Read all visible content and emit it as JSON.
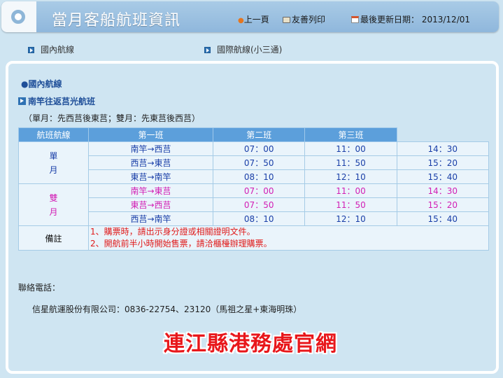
{
  "header": {
    "site_title": "當月客船航班資訊",
    "prev_link": "上一頁",
    "print_link": "友善列印",
    "update_label": "最後更新日期：",
    "update_date": "2013/12/01"
  },
  "nav": {
    "domestic": "國內航線",
    "international": "國際航線(小三通)"
  },
  "main": {
    "section_title": "●國內航線",
    "route_title": "南竿往返莒光航班",
    "route_note": "（單月：先西莒後東莒；雙月：先東莒後西莒）",
    "table": {
      "headers": [
        "航班航線",
        "第一班",
        "第二班",
        "第三班"
      ],
      "single_month_label": "單月",
      "double_month_label": "雙月",
      "single_rows": [
        {
          "route": "南竿→西莒",
          "t1": "07：00",
          "t2": "11：00",
          "t3": "14：30"
        },
        {
          "route": "西莒→東莒",
          "t1": "07：50",
          "t2": "11：50",
          "t3": "15：20"
        },
        {
          "route": "東莒→南竿",
          "t1": "08：10",
          "t2": "12：10",
          "t3": "15：40"
        }
      ],
      "double_rows": [
        {
          "route": "南竿→東莒",
          "t1": "07：00",
          "t2": "11：00",
          "t3": "14：30"
        },
        {
          "route": "東莒→西莒",
          "t1": "07：50",
          "t2": "11：50",
          "t3": "15：20"
        },
        {
          "route": "西莒→南竿",
          "t1": "08：10",
          "t2": "12：10",
          "t3": "15：40"
        }
      ],
      "remarks_label": "備註",
      "remarks": [
        "1、購票時，請出示身分證或相關證明文件。",
        "2、開航前半小時開始售票，請洽櫃檯辦理購票。"
      ]
    },
    "contact_label": "聯絡電話：",
    "contact_line": "信星航運股份有限公司：0836-22754、23120（馬祖之星+東海明珠）",
    "watermark": "連江縣港務處官網"
  },
  "colors": {
    "page_bg": "#cfe5f2",
    "header_bg": "#8fb7dc",
    "table_header_bg": "#5c9fdb",
    "single_month_text": "#1a3fa8",
    "double_month_text": "#d21fb5",
    "remarks_text": "#e01a1a",
    "watermark_text": "#e8171b"
  },
  "icons": [
    "logo-ring-icon",
    "bullet-dot-icon",
    "printer-icon",
    "calendar-icon",
    "nav-arrow-icon",
    "route-arrow-icon"
  ]
}
